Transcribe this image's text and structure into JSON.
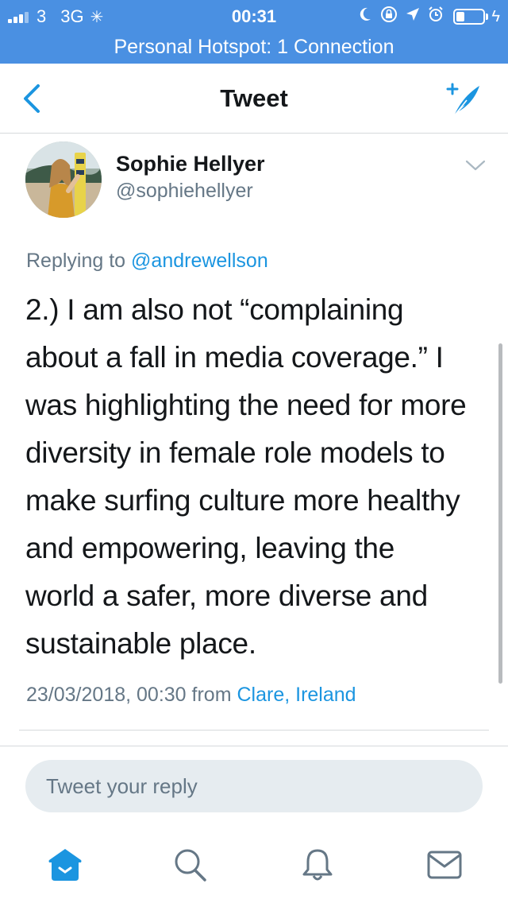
{
  "status_bar": {
    "carrier": "3",
    "network": "3G",
    "time": "00:31",
    "battery_level": 0.3
  },
  "hotspot": {
    "text": "Personal Hotspot: 1 Connection"
  },
  "nav": {
    "title": "Tweet"
  },
  "tweet": {
    "author_name": "Sophie Hellyer",
    "author_handle": "@sophiehellyer",
    "replying_prefix": "Replying to",
    "replying_mention": "@andrewellson",
    "text": "2.) I am also not “complaining about a fall in media coverage.” I was highlighting the need for more diversity in female role models to make surfing culture more healthy and empowering, leaving the world a safer, more diverse and sustainable place.",
    "timestamp": "23/03/2018, 00:30",
    "from_label": "from",
    "location": "Clare, Ireland"
  },
  "reply": {
    "placeholder": "Tweet your reply"
  },
  "tabs": [
    {
      "name": "home",
      "icon": "home-icon",
      "active": true
    },
    {
      "name": "search",
      "icon": "search-icon",
      "active": false
    },
    {
      "name": "notifications",
      "icon": "bell-icon",
      "active": false
    },
    {
      "name": "messages",
      "icon": "mail-icon",
      "active": false
    }
  ],
  "colors": {
    "accent": "#1b95e0",
    "status_bar": "#4a90e2",
    "secondary_text": "#657786"
  }
}
